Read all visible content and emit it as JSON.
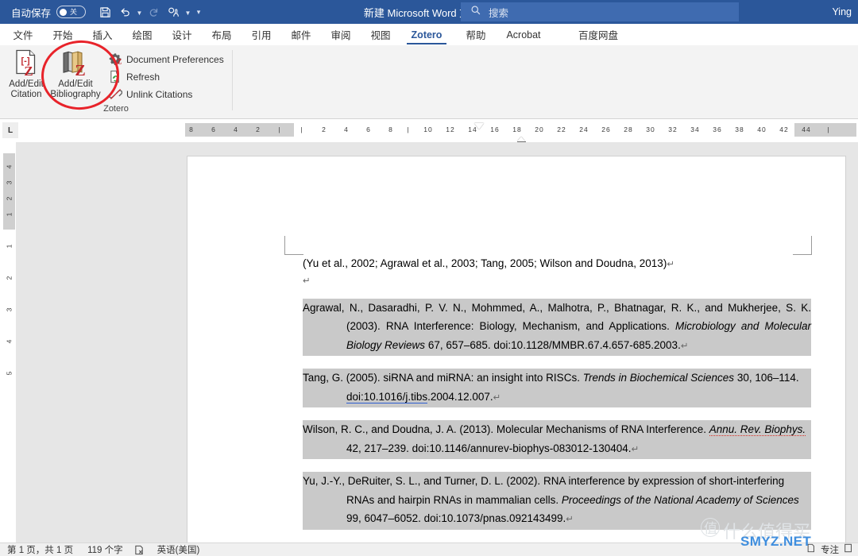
{
  "titlebar": {
    "autosave_label": "自动保存",
    "autosave_state": "关",
    "document_title": "新建 Microsoft Word 文...",
    "quick_access": [
      {
        "name": "save-icon",
        "label": "保存"
      },
      {
        "name": "undo-icon",
        "label": "撤消"
      },
      {
        "name": "redo-icon",
        "label": "恢复"
      },
      {
        "name": "touch-mode-icon",
        "label": "触摸/鼠标模式"
      }
    ],
    "search_placeholder": "搜索",
    "user_name": "Ying",
    "accent_color": "#2b579a"
  },
  "tabs": [
    {
      "label": "文件",
      "active": false
    },
    {
      "label": "开始",
      "active": false
    },
    {
      "label": "插入",
      "active": false
    },
    {
      "label": "绘图",
      "active": false
    },
    {
      "label": "设计",
      "active": false
    },
    {
      "label": "布局",
      "active": false
    },
    {
      "label": "引用",
      "active": false
    },
    {
      "label": "邮件",
      "active": false
    },
    {
      "label": "审阅",
      "active": false
    },
    {
      "label": "视图",
      "active": false
    },
    {
      "label": "Zotero",
      "active": true
    },
    {
      "label": "帮助",
      "active": false
    },
    {
      "label": "Acrobat",
      "active": false
    },
    {
      "label": "百度网盘",
      "active": false
    }
  ],
  "ribbon": {
    "group_label": "Zotero",
    "big_buttons": [
      {
        "label_line1": "Add/Edit",
        "label_line2": "Citation",
        "icon": "add-edit-citation-icon"
      },
      {
        "label_line1": "Add/Edit",
        "label_line2": "Bibliography",
        "icon": "add-edit-bibliography-icon"
      }
    ],
    "small_commands": [
      {
        "label": "Document Preferences",
        "icon": "document-preferences-icon"
      },
      {
        "label": "Refresh",
        "icon": "refresh-icon"
      },
      {
        "label": "Unlink Citations",
        "icon": "unlink-citations-icon"
      }
    ],
    "annotation": {
      "shape": "ellipse",
      "color": "#e8232a",
      "targets": "add-edit-bibliography-button"
    }
  },
  "ruler": {
    "tab_selector_label": "L",
    "horizontal_ticks": [
      "8",
      "6",
      "4",
      "2",
      "2",
      "4",
      "6",
      "8",
      "10",
      "12",
      "14",
      "16",
      "18",
      "20",
      "22",
      "24",
      "26",
      "28",
      "30",
      "32",
      "34",
      "36",
      "38",
      "40",
      "42",
      "44"
    ],
    "vertical_ticks": [
      "4",
      "3",
      "2",
      "1",
      "1",
      "2",
      "3",
      "4",
      "5"
    ]
  },
  "document": {
    "citation_line": "(Yu et al., 2002; Agrawal et al., 2003; Tang, 2005; Wilson and Doudna, 2013)",
    "bibliography": [
      {
        "id": "agrawal-2003",
        "authors": "Agrawal, N., Dasaradhi, P. V. N., Mohmmed, A., Malhotra, P., Bhatnagar, R. K., and Mukherjee, S. K.",
        "year": "(2003).",
        "title": "RNA Interference: Biology, Mechanism, and Applications.",
        "journal": "Microbiology and Molecular Biology Reviews",
        "volume_pages": "67, 657–685.",
        "doi": "doi:10.1128/MMBR.67.4.657-685.2003."
      },
      {
        "id": "tang-2005",
        "authors": "Tang, G.",
        "year": "(2005).",
        "title": "siRNA and miRNA: an insight into RISCs.",
        "journal": "Trends in Biochemical Sciences",
        "volume_pages": "30, 106–114.",
        "doi_link": "doi:10.1016/j.tibs",
        "doi_rest": ".2004.12.007."
      },
      {
        "id": "wilson-2013",
        "authors": "Wilson, R. C., and Doudna, J. A.",
        "year": "(2013).",
        "title": "Molecular Mechanisms of RNA Interference.",
        "journal": "Annu. Rev. Biophys.",
        "volume_pages": "42, 217–239.",
        "doi": "doi:10.1146/annurev-biophys-083012-130404."
      },
      {
        "id": "yu-2002",
        "authors": "Yu, J.-Y., DeRuiter, S. L., and Turner, D. L.",
        "year": "(2002).",
        "title": "RNA interference by expression of short-interfering RNAs and hairpin RNAs in mammalian cells.",
        "journal": "Proceedings of the National Academy of Sciences",
        "volume_pages": "99, 6047–6052.",
        "doi": "doi:10.1073/pnas.092143499."
      }
    ],
    "field_shading_color": "#c9c9c9"
  },
  "watermark": {
    "cn_text": "什么值得买",
    "badge_text": "值",
    "site": "SMYZ.NET",
    "site_color": "#3f8ede"
  },
  "statusbar": {
    "page_info": "第 1 页，共 1 页",
    "word_count": "119 个字",
    "proofing_icon": "proofing-errors-icon",
    "language": "英语(美国)",
    "focus_label": "专注",
    "focus_icon": "focus-mode-icon"
  }
}
